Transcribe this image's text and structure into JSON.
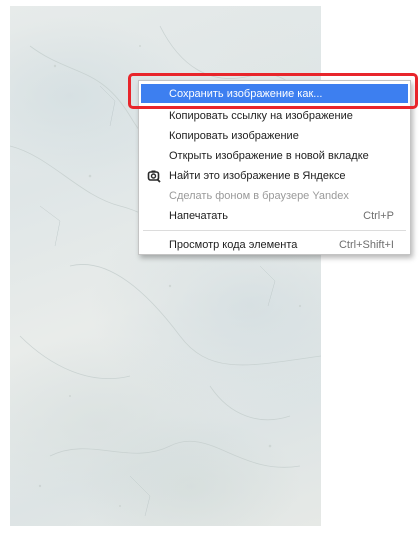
{
  "context_menu": {
    "items": [
      {
        "label": "Сохранить изображение как...",
        "shortcut": "",
        "state": "highlighted"
      },
      {
        "label": "Копировать ссылку на изображение",
        "shortcut": "",
        "state": "normal"
      },
      {
        "label": "Копировать изображение",
        "shortcut": "",
        "state": "normal"
      },
      {
        "label": "Открыть изображение в новой вкладке",
        "shortcut": "",
        "state": "normal"
      },
      {
        "label": "Найти это изображение в Яндексе",
        "shortcut": "",
        "state": "normal",
        "icon": "camera-search-icon"
      },
      {
        "label": "Сделать фоном в браузере Yandex",
        "shortcut": "",
        "state": "disabled"
      },
      {
        "label": "Напечатать",
        "shortcut": "Ctrl+P",
        "state": "normal"
      },
      {
        "label": "Просмотр кода элемента",
        "shortcut": "Ctrl+Shift+I",
        "state": "normal"
      }
    ]
  },
  "colors": {
    "highlight": "#3d7ff0",
    "annotation_frame": "#e8252b",
    "disabled_text": "#9a9a9a"
  },
  "background_image": {
    "description_icon": "marble-texture-image"
  }
}
